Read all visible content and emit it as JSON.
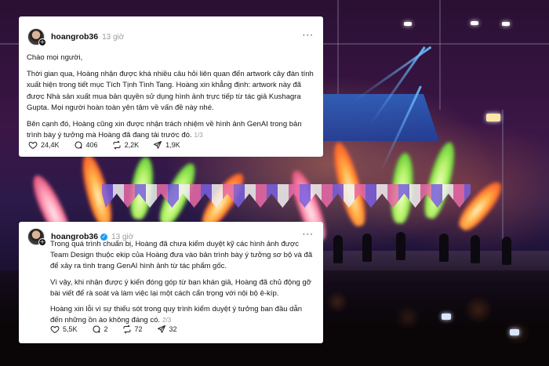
{
  "posts": [
    {
      "username": "hoangrob36",
      "time": "13 giờ",
      "more_icon": "more-dots-icon",
      "paragraphs": [
        "Chào mọi người,",
        "Thời gian qua, Hoàng nhận được khá nhiều câu hỏi liên quan đến artwork cây đàn tính xuất hiện trong tiết mục Tích Tịnh Tình Tang. Hoàng xin khẳng định: artwork này đã được Nhà sản xuất mua bản quyền sử dụng hình ảnh trực tiếp từ tác giả Kushagra Gupta. Mọi người hoàn toàn yên tâm về vấn đề này nhé.",
        "Bên cạnh đó, Hoàng cũng xin được nhận trách nhiệm về hình ảnh GenAI trong bản trình bày ý tưởng mà Hoàng đã đang tải trước đó."
      ],
      "page_indicator": "1/3",
      "likes": "24,4K",
      "comments": "406",
      "reposts": "2,2K",
      "shares": "1,9K"
    },
    {
      "username": "hoangrob36",
      "time": "13 giờ",
      "more_icon": "more-dots-icon",
      "paragraphs": [
        "Trong quá trình chuẩn bị, Hoàng đã chưa kiểm duyệt kỹ các hình ảnh được Team Design thuộc ekip của Hoàng đưa vào bản trình bày ý tưởng sơ bộ và đã để xảy ra tình trạng GenAI hình ảnh từ tác phẩm gốc.",
        "Vì vậy, khi nhận được ý kiến đóng góp từ bạn khán giả, Hoàng đã chủ động gỡ bài viết để rà soát và làm việc lại một cách cẩn trọng với nội bộ ê-kíp.",
        "Hoàng xin lỗi vì sự thiếu sót trong quy trình kiểm duyệt ý tưởng ban đầu dẫn đến những ồn ào không đáng có."
      ],
      "page_indicator": "2/3",
      "likes": "5,5K",
      "comments": "2",
      "reposts": "72",
      "shares": "32"
    }
  ]
}
